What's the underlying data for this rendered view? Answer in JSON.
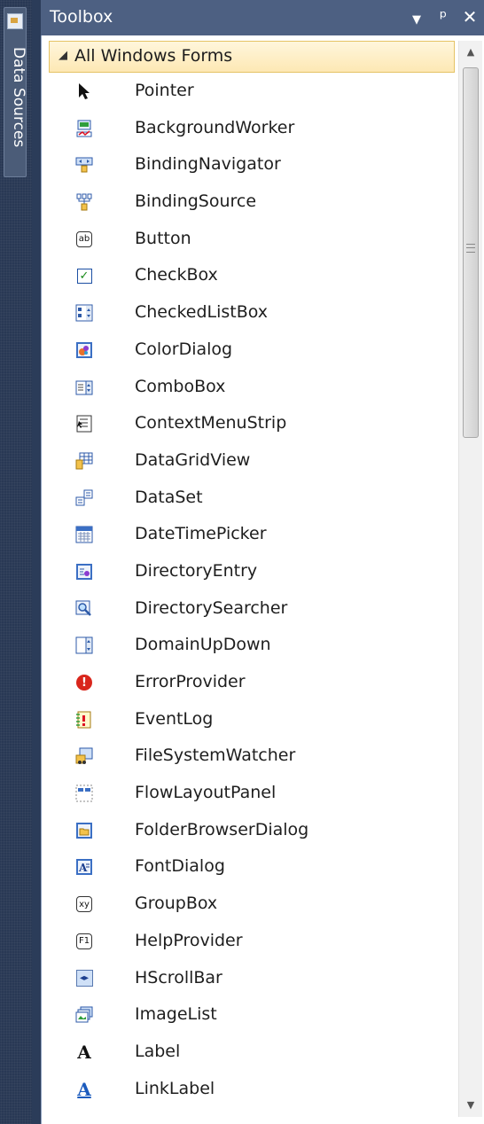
{
  "side_tab": {
    "label": "Data Sources",
    "icon": "data-sources-icon"
  },
  "toolbox": {
    "title": "Toolbox",
    "buttons": {
      "dropdown": "▼",
      "pin": "📌",
      "close": "✕"
    }
  },
  "category": {
    "label": "All Windows Forms",
    "expanded_glyph": "◢"
  },
  "items": [
    {
      "label": "Pointer",
      "icon": "pointer-icon"
    },
    {
      "label": "BackgroundWorker",
      "icon": "background-worker-icon"
    },
    {
      "label": "BindingNavigator",
      "icon": "binding-navigator-icon"
    },
    {
      "label": "BindingSource",
      "icon": "binding-source-icon"
    },
    {
      "label": "Button",
      "icon": "button-icon",
      "glyph": "ab"
    },
    {
      "label": "CheckBox",
      "icon": "checkbox-icon",
      "glyph": "✓"
    },
    {
      "label": "CheckedListBox",
      "icon": "checked-list-box-icon"
    },
    {
      "label": "ColorDialog",
      "icon": "color-dialog-icon"
    },
    {
      "label": "ComboBox",
      "icon": "combo-box-icon"
    },
    {
      "label": "ContextMenuStrip",
      "icon": "context-menu-strip-icon"
    },
    {
      "label": "DataGridView",
      "icon": "data-grid-view-icon"
    },
    {
      "label": "DataSet",
      "icon": "data-set-icon"
    },
    {
      "label": "DateTimePicker",
      "icon": "date-time-picker-icon"
    },
    {
      "label": "DirectoryEntry",
      "icon": "directory-entry-icon"
    },
    {
      "label": "DirectorySearcher",
      "icon": "directory-searcher-icon"
    },
    {
      "label": "DomainUpDown",
      "icon": "domain-up-down-icon"
    },
    {
      "label": "ErrorProvider",
      "icon": "error-provider-icon",
      "glyph": "!"
    },
    {
      "label": "EventLog",
      "icon": "event-log-icon"
    },
    {
      "label": "FileSystemWatcher",
      "icon": "file-system-watcher-icon"
    },
    {
      "label": "FlowLayoutPanel",
      "icon": "flow-layout-panel-icon"
    },
    {
      "label": "FolderBrowserDialog",
      "icon": "folder-browser-dialog-icon"
    },
    {
      "label": "FontDialog",
      "icon": "font-dialog-icon"
    },
    {
      "label": "GroupBox",
      "icon": "group-box-icon",
      "glyph": "xy"
    },
    {
      "label": "HelpProvider",
      "icon": "help-provider-icon",
      "glyph": "F1"
    },
    {
      "label": "HScrollBar",
      "icon": "hscrollbar-icon",
      "glyph": "◂▸"
    },
    {
      "label": "ImageList",
      "icon": "image-list-icon"
    },
    {
      "label": "Label",
      "icon": "label-icon",
      "glyph": "A"
    },
    {
      "label": "LinkLabel",
      "icon": "link-label-icon",
      "glyph": "A"
    }
  ],
  "scrollbar": {
    "up_glyph": "▲",
    "down_glyph": "▼",
    "position_fraction": 0.0
  }
}
